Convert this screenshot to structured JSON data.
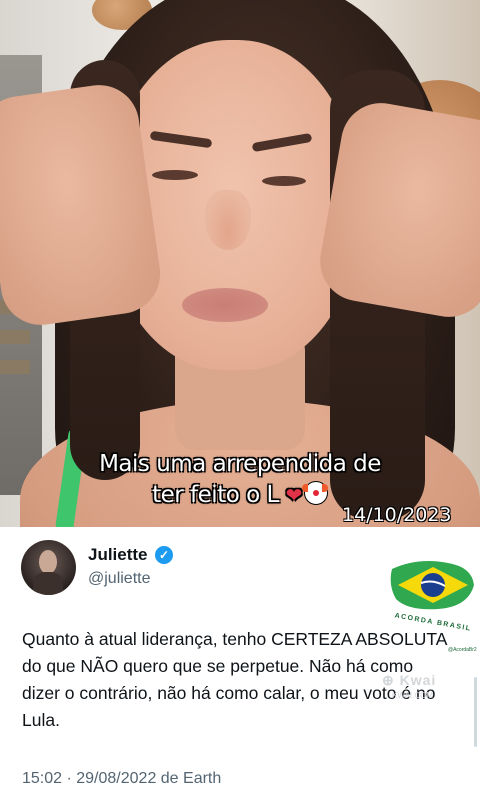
{
  "video": {
    "caption_line1": "Mais uma arrependida de",
    "caption_line2": "ter feito o L",
    "caption_emojis": [
      "heart-with-bandage",
      "clown-face"
    ],
    "date": "14/10/2023"
  },
  "tweet": {
    "display_name": "Juliette",
    "verified": true,
    "handle": "@juliette",
    "text": "Quanto à atual liderança, tenho CERTEZA ABSOLUTA do que NÃO quero que se perpetue. Não há como dizer o contrário, não há como calar, o meu voto é no Lula.",
    "meta": "15:02 · 29/08/2022 de Earth"
  },
  "overlay_logo": {
    "title": "ACORDA BRASIL",
    "sub": "@AcordaBr2"
  },
  "colors": {
    "caption_text": "#ffffff",
    "verified_badge": "#1d9bf0",
    "secondary_text": "#536471",
    "primary_text": "#0f1419",
    "flag_green": "#2fa84f",
    "flag_yellow": "#f5d90a",
    "flag_blue": "#1b3f8f"
  }
}
